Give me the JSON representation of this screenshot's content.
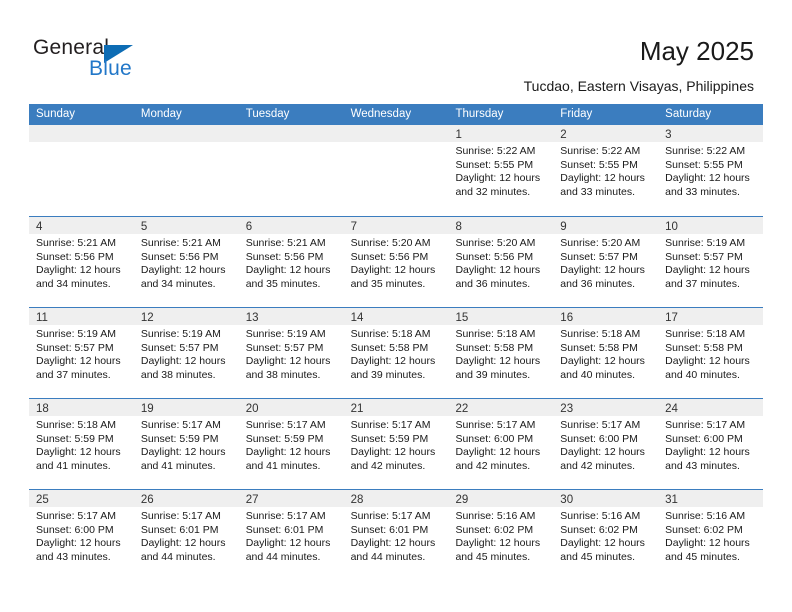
{
  "brand": {
    "name_top": "General",
    "name_bottom": "Blue",
    "accent_color": "#0d6cb4",
    "blue_text_color": "#2277c8"
  },
  "header": {
    "title": "May 2025",
    "subtitle": "Tucdao, Eastern Visayas, Philippines"
  },
  "calendar": {
    "header_bg": "#3b7dbf",
    "day_strip_bg": "#efefef",
    "weekdays": [
      "Sunday",
      "Monday",
      "Tuesday",
      "Wednesday",
      "Thursday",
      "Friday",
      "Saturday"
    ],
    "weeks": [
      [
        {
          "day": "",
          "empty": true
        },
        {
          "day": "",
          "empty": true
        },
        {
          "day": "",
          "empty": true
        },
        {
          "day": "",
          "empty": true
        },
        {
          "day": "1",
          "sunrise": "Sunrise: 5:22 AM",
          "sunset": "Sunset: 5:55 PM",
          "daylight1": "Daylight: 12 hours",
          "daylight2": "and 32 minutes."
        },
        {
          "day": "2",
          "sunrise": "Sunrise: 5:22 AM",
          "sunset": "Sunset: 5:55 PM",
          "daylight1": "Daylight: 12 hours",
          "daylight2": "and 33 minutes."
        },
        {
          "day": "3",
          "sunrise": "Sunrise: 5:22 AM",
          "sunset": "Sunset: 5:55 PM",
          "daylight1": "Daylight: 12 hours",
          "daylight2": "and 33 minutes."
        }
      ],
      [
        {
          "day": "4",
          "sunrise": "Sunrise: 5:21 AM",
          "sunset": "Sunset: 5:56 PM",
          "daylight1": "Daylight: 12 hours",
          "daylight2": "and 34 minutes."
        },
        {
          "day": "5",
          "sunrise": "Sunrise: 5:21 AM",
          "sunset": "Sunset: 5:56 PM",
          "daylight1": "Daylight: 12 hours",
          "daylight2": "and 34 minutes."
        },
        {
          "day": "6",
          "sunrise": "Sunrise: 5:21 AM",
          "sunset": "Sunset: 5:56 PM",
          "daylight1": "Daylight: 12 hours",
          "daylight2": "and 35 minutes."
        },
        {
          "day": "7",
          "sunrise": "Sunrise: 5:20 AM",
          "sunset": "Sunset: 5:56 PM",
          "daylight1": "Daylight: 12 hours",
          "daylight2": "and 35 minutes."
        },
        {
          "day": "8",
          "sunrise": "Sunrise: 5:20 AM",
          "sunset": "Sunset: 5:56 PM",
          "daylight1": "Daylight: 12 hours",
          "daylight2": "and 36 minutes."
        },
        {
          "day": "9",
          "sunrise": "Sunrise: 5:20 AM",
          "sunset": "Sunset: 5:57 PM",
          "daylight1": "Daylight: 12 hours",
          "daylight2": "and 36 minutes."
        },
        {
          "day": "10",
          "sunrise": "Sunrise: 5:19 AM",
          "sunset": "Sunset: 5:57 PM",
          "daylight1": "Daylight: 12 hours",
          "daylight2": "and 37 minutes."
        }
      ],
      [
        {
          "day": "11",
          "sunrise": "Sunrise: 5:19 AM",
          "sunset": "Sunset: 5:57 PM",
          "daylight1": "Daylight: 12 hours",
          "daylight2": "and 37 minutes."
        },
        {
          "day": "12",
          "sunrise": "Sunrise: 5:19 AM",
          "sunset": "Sunset: 5:57 PM",
          "daylight1": "Daylight: 12 hours",
          "daylight2": "and 38 minutes."
        },
        {
          "day": "13",
          "sunrise": "Sunrise: 5:19 AM",
          "sunset": "Sunset: 5:57 PM",
          "daylight1": "Daylight: 12 hours",
          "daylight2": "and 38 minutes."
        },
        {
          "day": "14",
          "sunrise": "Sunrise: 5:18 AM",
          "sunset": "Sunset: 5:58 PM",
          "daylight1": "Daylight: 12 hours",
          "daylight2": "and 39 minutes."
        },
        {
          "day": "15",
          "sunrise": "Sunrise: 5:18 AM",
          "sunset": "Sunset: 5:58 PM",
          "daylight1": "Daylight: 12 hours",
          "daylight2": "and 39 minutes."
        },
        {
          "day": "16",
          "sunrise": "Sunrise: 5:18 AM",
          "sunset": "Sunset: 5:58 PM",
          "daylight1": "Daylight: 12 hours",
          "daylight2": "and 40 minutes."
        },
        {
          "day": "17",
          "sunrise": "Sunrise: 5:18 AM",
          "sunset": "Sunset: 5:58 PM",
          "daylight1": "Daylight: 12 hours",
          "daylight2": "and 40 minutes."
        }
      ],
      [
        {
          "day": "18",
          "sunrise": "Sunrise: 5:18 AM",
          "sunset": "Sunset: 5:59 PM",
          "daylight1": "Daylight: 12 hours",
          "daylight2": "and 41 minutes."
        },
        {
          "day": "19",
          "sunrise": "Sunrise: 5:17 AM",
          "sunset": "Sunset: 5:59 PM",
          "daylight1": "Daylight: 12 hours",
          "daylight2": "and 41 minutes."
        },
        {
          "day": "20",
          "sunrise": "Sunrise: 5:17 AM",
          "sunset": "Sunset: 5:59 PM",
          "daylight1": "Daylight: 12 hours",
          "daylight2": "and 41 minutes."
        },
        {
          "day": "21",
          "sunrise": "Sunrise: 5:17 AM",
          "sunset": "Sunset: 5:59 PM",
          "daylight1": "Daylight: 12 hours",
          "daylight2": "and 42 minutes."
        },
        {
          "day": "22",
          "sunrise": "Sunrise: 5:17 AM",
          "sunset": "Sunset: 6:00 PM",
          "daylight1": "Daylight: 12 hours",
          "daylight2": "and 42 minutes."
        },
        {
          "day": "23",
          "sunrise": "Sunrise: 5:17 AM",
          "sunset": "Sunset: 6:00 PM",
          "daylight1": "Daylight: 12 hours",
          "daylight2": "and 42 minutes."
        },
        {
          "day": "24",
          "sunrise": "Sunrise: 5:17 AM",
          "sunset": "Sunset: 6:00 PM",
          "daylight1": "Daylight: 12 hours",
          "daylight2": "and 43 minutes."
        }
      ],
      [
        {
          "day": "25",
          "sunrise": "Sunrise: 5:17 AM",
          "sunset": "Sunset: 6:00 PM",
          "daylight1": "Daylight: 12 hours",
          "daylight2": "and 43 minutes."
        },
        {
          "day": "26",
          "sunrise": "Sunrise: 5:17 AM",
          "sunset": "Sunset: 6:01 PM",
          "daylight1": "Daylight: 12 hours",
          "daylight2": "and 44 minutes."
        },
        {
          "day": "27",
          "sunrise": "Sunrise: 5:17 AM",
          "sunset": "Sunset: 6:01 PM",
          "daylight1": "Daylight: 12 hours",
          "daylight2": "and 44 minutes."
        },
        {
          "day": "28",
          "sunrise": "Sunrise: 5:17 AM",
          "sunset": "Sunset: 6:01 PM",
          "daylight1": "Daylight: 12 hours",
          "daylight2": "and 44 minutes."
        },
        {
          "day": "29",
          "sunrise": "Sunrise: 5:16 AM",
          "sunset": "Sunset: 6:02 PM",
          "daylight1": "Daylight: 12 hours",
          "daylight2": "and 45 minutes."
        },
        {
          "day": "30",
          "sunrise": "Sunrise: 5:16 AM",
          "sunset": "Sunset: 6:02 PM",
          "daylight1": "Daylight: 12 hours",
          "daylight2": "and 45 minutes."
        },
        {
          "day": "31",
          "sunrise": "Sunrise: 5:16 AM",
          "sunset": "Sunset: 6:02 PM",
          "daylight1": "Daylight: 12 hours",
          "daylight2": "and 45 minutes."
        }
      ]
    ]
  }
}
